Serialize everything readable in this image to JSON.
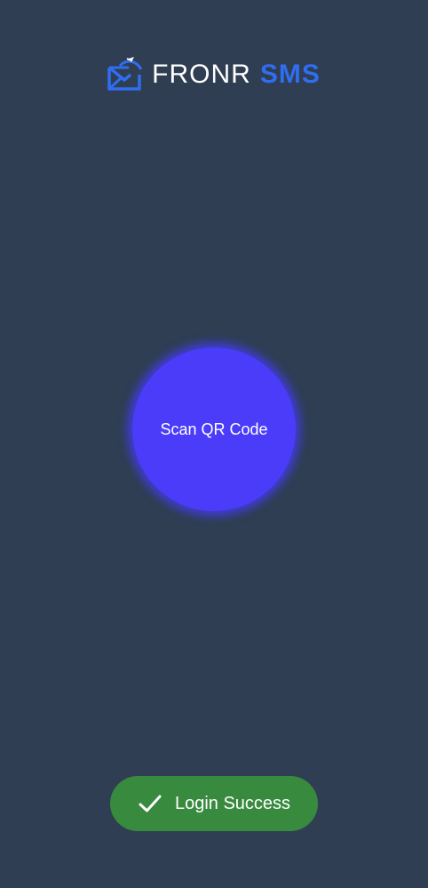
{
  "header": {
    "brand_name": "FRONR",
    "brand_accent": "SMS",
    "logo_icon": "envelope-send-icon"
  },
  "main": {
    "scan_button_label": "Scan QR Code"
  },
  "toast": {
    "message": "Login Success",
    "icon": "check-icon"
  },
  "colors": {
    "background": "#2f3e52",
    "accent_blue": "#2f6ef0",
    "scan_button": "#4b3cfa",
    "scan_glow": "#3f3ccf",
    "toast_bg": "#388a3e",
    "text": "#ffffff"
  }
}
